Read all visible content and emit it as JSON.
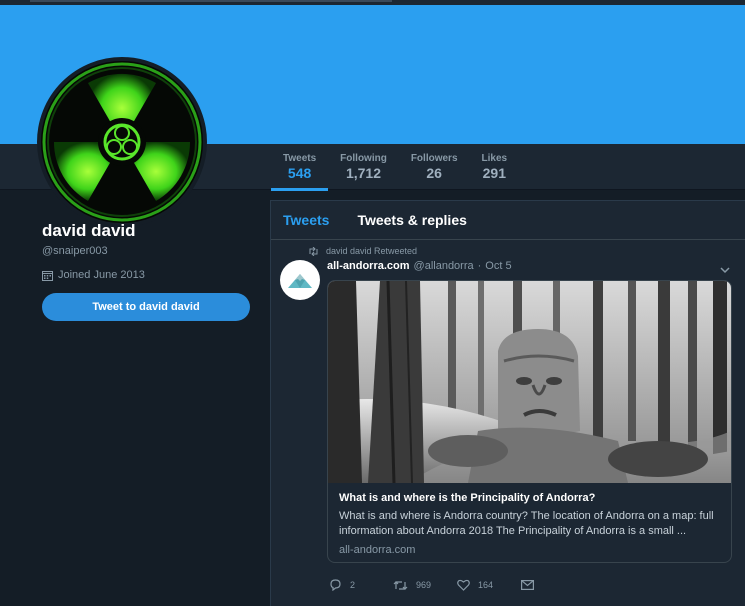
{
  "profile": {
    "name": "david david",
    "handle": "@snaiper003",
    "joined": "Joined June 2013",
    "tweet_to_label": "Tweet to david david"
  },
  "stats": [
    {
      "label": "Tweets",
      "value": "548",
      "active": true
    },
    {
      "label": "Following",
      "value": "1,712",
      "active": false
    },
    {
      "label": "Followers",
      "value": "26",
      "active": false
    },
    {
      "label": "Likes",
      "value": "291",
      "active": false
    }
  ],
  "timeline": {
    "tabs": [
      {
        "label": "Tweets",
        "active": true
      },
      {
        "label": "Tweets & replies",
        "active": false
      }
    ],
    "tweet": {
      "retweeted_by": "david david Retweeted",
      "author_name": "all-andorra.com",
      "author_handle": "@allandorra",
      "separator": "·",
      "date": "Oct 5",
      "card": {
        "title": "What is and where is the Principality of Andorra?",
        "description": "What is and where is Andorra country? The location of Andorra on a map: full information about Andorra 2018 The Principality of Andorra is a small ...",
        "domain": "all-andorra.com"
      },
      "actions": {
        "replies": "2",
        "retweets": "969",
        "likes": "164"
      }
    }
  },
  "colors": {
    "accent": "#2b9ff0",
    "background": "#141d26",
    "panel": "#1c2733",
    "muted": "#8899a6"
  },
  "icons": {
    "avatar": "radioactive-biohazard-icon",
    "calendar": "calendar-icon",
    "retweet": "retweet-icon",
    "reply": "reply-icon",
    "like": "heart-icon",
    "message": "envelope-icon",
    "caret": "chevron-down-icon"
  }
}
